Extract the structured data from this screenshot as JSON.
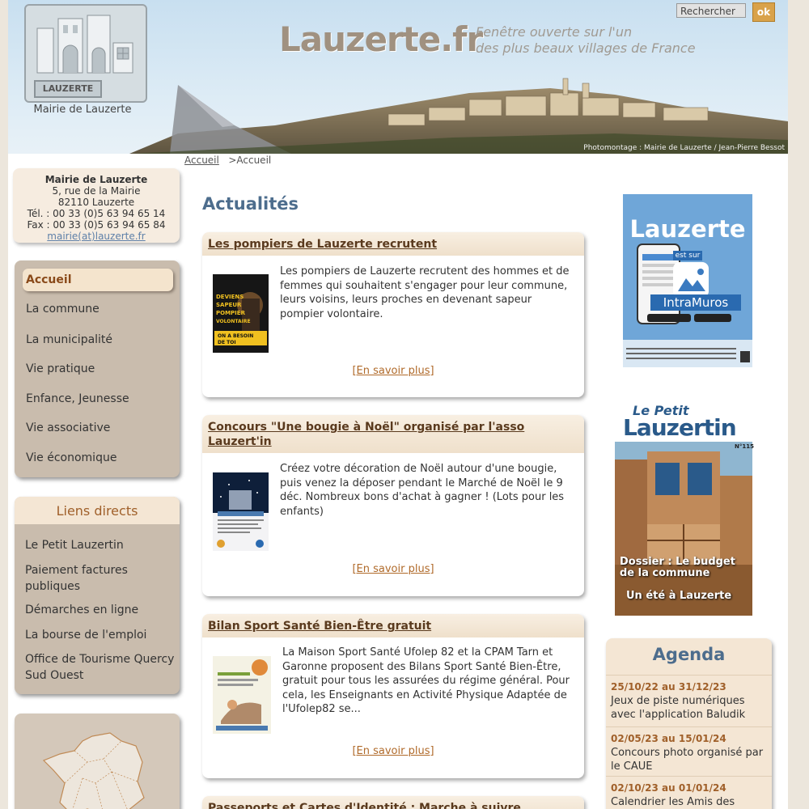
{
  "header": {
    "logo_word": "LAUZERTE",
    "logo_caption": "Mairie de Lauzerte",
    "site_title": "Lauzerte.fr",
    "tagline_line1": "Fenêtre ouverte sur l'un",
    "tagline_line2": "des plus beaux villages de France",
    "search_placeholder": "Rechercher",
    "search_button": "ok",
    "photo_credit": "Photomontage : Mairie de Lauzerte / Jean-Pierre Bessot"
  },
  "breadcrumb": {
    "home_link": "Accueil",
    "current": ">Accueil"
  },
  "contact": {
    "name": "Mairie de Lauzerte",
    "street": "5, rue de la Mairie",
    "city": "82110 Lauzerte",
    "tel": "Tél. : 00 33 (0)5 63 94 65 14",
    "fax": "Fax : 00 33 (0)5 63 94 65 84",
    "email": "mairie(at)lauzerte.fr"
  },
  "nav": {
    "active": "Accueil",
    "items": [
      "La commune",
      "La municipalité",
      "Vie pratique",
      "Enfance, Jeunesse",
      "Vie associative",
      "Vie économique"
    ]
  },
  "links": {
    "title": "Liens directs",
    "items": [
      "Le Petit Lauzertin",
      "Paiement factures publiques",
      "Démarches en ligne",
      "La bourse de l'emploi",
      "Office de Tourisme Quercy Sud Ouest"
    ]
  },
  "main": {
    "title": "Actualités",
    "more_label": "[En savoir plus]",
    "articles": [
      {
        "title": "Les pompiers de Lauzerte recrutent",
        "text": "Les pompiers de Lauzerte recrutent des hommes et de femmes qui souhaitent s'engager pour leur commune, leurs voisins, leurs proches en devenant sapeur pompier volontaire.",
        "img_text": "DEVIENS SAPEUR POMPIER VOLONTAIRE",
        "img_sub": "ON A BESOIN DE TOI"
      },
      {
        "title": "Concours \"Une bougie à Noël\" organisé par l'asso Lauzert'in",
        "text": "Créez votre décoration de Noël autour d'une bougie, puis venez la déposer pendant le Marché de Noël le 9 déc. Nombreux bons d'achat à gagner ! (Lots pour les enfants)"
      },
      {
        "title": "Bilan Sport Santé Bien-Être gratuit",
        "text": "La Maison Sport Santé Ufolep 82 et la CPAM Tarn et Garonne proposent des Bilans Sport Santé Bien-Être, gratuit pour tous les assurées du régime général. Pour cela, les Enseignants en Activité Physique Adaptée de l'Ufolep82 se..."
      },
      {
        "title": "Passeports et Cartes d'Identité : Marche à suivre"
      }
    ]
  },
  "right": {
    "intramuros": {
      "title": "Lauzerte",
      "sub": "est sur",
      "app": "IntraMuros"
    },
    "petit_lauzertin": {
      "title_small": "Le Petit",
      "title_big": "Lauzertin",
      "issue": "N°115",
      "headline1": "Dossier : Le budget de la commune",
      "headline2": "Un été à Lauzerte"
    },
    "agenda": {
      "title": "Agenda",
      "events": [
        {
          "dates": "25/10/22 au 31/12/23",
          "text": "Jeux de piste numériques avec l'application Baludik"
        },
        {
          "dates": "02/05/23 au 15/01/24",
          "text": "Concours photo organisé par le CAUE"
        },
        {
          "dates": "02/10/23 au 01/01/24",
          "text": "Calendrier les Amis des"
        }
      ]
    }
  }
}
